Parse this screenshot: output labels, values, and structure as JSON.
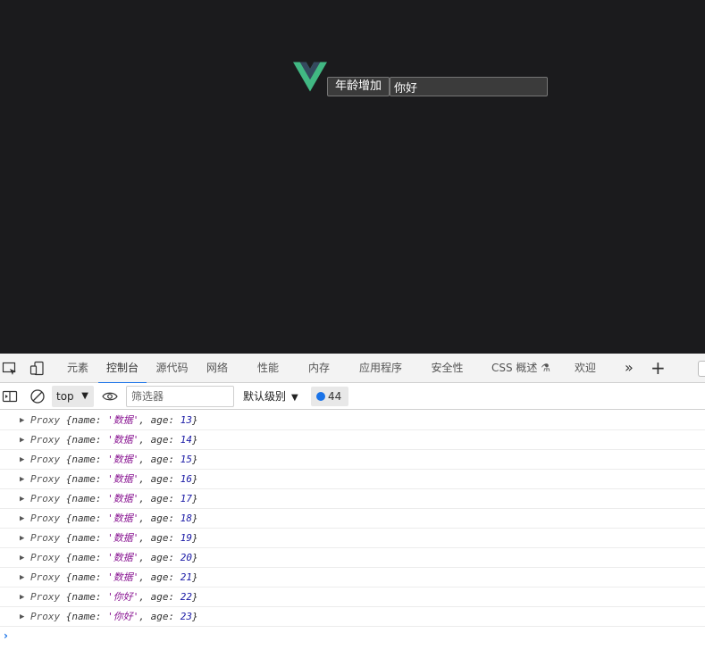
{
  "app": {
    "age_button_label": "年龄增加",
    "name_input_value": "你好",
    "logo_colors": {
      "outer": "#41b883",
      "inner": "#34495e"
    }
  },
  "devtools": {
    "tabs": [
      {
        "label": "元素"
      },
      {
        "label": "控制台"
      },
      {
        "label": "源代码"
      },
      {
        "label": "网络"
      },
      {
        "label": "性能"
      },
      {
        "label": "内存"
      },
      {
        "label": "应用程序"
      },
      {
        "label": "安全性"
      },
      {
        "label": "CSS 概述 ⚗"
      },
      {
        "label": "欢迎"
      }
    ],
    "active_tab": "控制台",
    "more_tabs_glyph": "»",
    "add_tab_glyph": "+",
    "toolbar": {
      "context": "top",
      "filter_placeholder": "筛选器",
      "levels_label": "默认级别",
      "issues_count": "44"
    },
    "console_logs": [
      {
        "prefix": "Proxy",
        "name": "'数据'",
        "age": "13"
      },
      {
        "prefix": "Proxy",
        "name": "'数据'",
        "age": "14"
      },
      {
        "prefix": "Proxy",
        "name": "'数据'",
        "age": "15"
      },
      {
        "prefix": "Proxy",
        "name": "'数据'",
        "age": "16"
      },
      {
        "prefix": "Proxy",
        "name": "'数据'",
        "age": "17"
      },
      {
        "prefix": "Proxy",
        "name": "'数据'",
        "age": "18"
      },
      {
        "prefix": "Proxy",
        "name": "'数据'",
        "age": "19"
      },
      {
        "prefix": "Proxy",
        "name": "'数据'",
        "age": "20"
      },
      {
        "prefix": "Proxy",
        "name": "'数据'",
        "age": "21"
      },
      {
        "prefix": "Proxy",
        "name": "'你好'",
        "age": "22"
      },
      {
        "prefix": "Proxy",
        "name": "'你好'",
        "age": "23"
      }
    ],
    "prompt_glyph": "›",
    "accent_color": "#1a73e8"
  }
}
